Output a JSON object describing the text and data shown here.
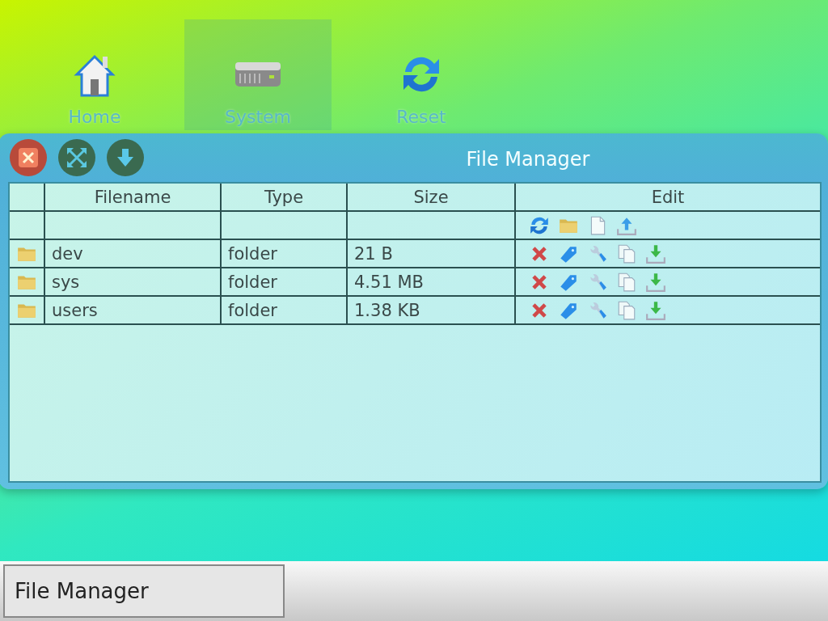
{
  "desktop_icons": [
    {
      "label": "Home",
      "kind": "home",
      "selected": false
    },
    {
      "label": "System",
      "kind": "drive",
      "selected": true
    },
    {
      "label": "Reset",
      "kind": "refresh",
      "selected": false
    }
  ],
  "window": {
    "title": "File Manager",
    "table": {
      "columns": [
        "Filename",
        "Type",
        "Size",
        "Edit"
      ],
      "rows": [
        {
          "name": "dev",
          "type": "folder",
          "size": "21 B"
        },
        {
          "name": "sys",
          "type": "folder",
          "size": "4.51 MB"
        },
        {
          "name": "users",
          "type": "folder",
          "size": "1.38 KB"
        }
      ]
    }
  },
  "taskbar": {
    "buttons": [
      {
        "label": "File Manager"
      }
    ]
  }
}
